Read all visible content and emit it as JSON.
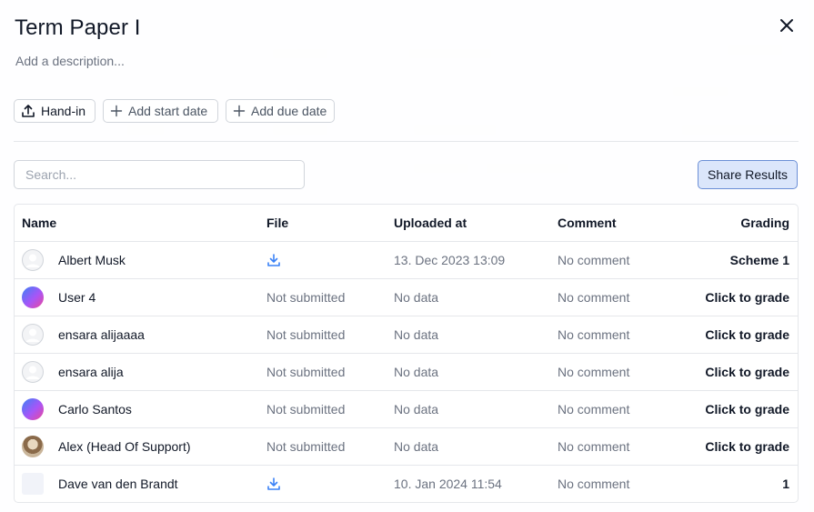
{
  "modal": {
    "title": "Term Paper I",
    "description_placeholder": "Add a description..."
  },
  "actions": {
    "handin_label": "Hand-in",
    "start_date_label": "Add start date",
    "due_date_label": "Add due date"
  },
  "search": {
    "placeholder": "Search..."
  },
  "share_label": "Share Results",
  "table": {
    "headers": {
      "name": "Name",
      "file": "File",
      "uploaded": "Uploaded at",
      "comment": "Comment",
      "grading": "Grading"
    },
    "rows": [
      {
        "name": "Albert Musk",
        "avatar": "default-avatar-icon",
        "file": "",
        "file_icon": "download-icon",
        "uploaded": "13. Dec 2023 13:09",
        "comment": "No comment",
        "grading": "Scheme 1"
      },
      {
        "name": "User 4",
        "avatar": "gradient-avatar",
        "file": "Not submitted",
        "file_icon": "",
        "uploaded": "No data",
        "comment": "No comment",
        "grading": "Click to grade"
      },
      {
        "name": "ensara alijaaaa",
        "avatar": "default-avatar-icon",
        "file": "Not submitted",
        "file_icon": "",
        "uploaded": "No data",
        "comment": "No comment",
        "grading": "Click to grade"
      },
      {
        "name": "ensara alija",
        "avatar": "default-avatar-icon",
        "file": "Not submitted",
        "file_icon": "",
        "uploaded": "No data",
        "comment": "No comment",
        "grading": "Click to grade"
      },
      {
        "name": "Carlo Santos",
        "avatar": "gradient-avatar",
        "file": "Not submitted",
        "file_icon": "",
        "uploaded": "No data",
        "comment": "No comment",
        "grading": "Click to grade"
      },
      {
        "name": "Alex (Head Of Support)",
        "avatar": "photo-avatar",
        "file": "Not submitted",
        "file_icon": "",
        "uploaded": "No data",
        "comment": "No comment",
        "grading": "Click to grade"
      },
      {
        "name": "Dave van den Brandt",
        "avatar": "blank-avatar",
        "file": "",
        "file_icon": "download-icon",
        "uploaded": "10. Jan 2024 11:54",
        "comment": "No comment",
        "grading": "1"
      }
    ]
  },
  "colors": {
    "accent_border": "#6b8fd6",
    "accent_fill": "#dbe6fb",
    "download_icon": "#3b82f6",
    "muted_text": "#6b7280"
  }
}
